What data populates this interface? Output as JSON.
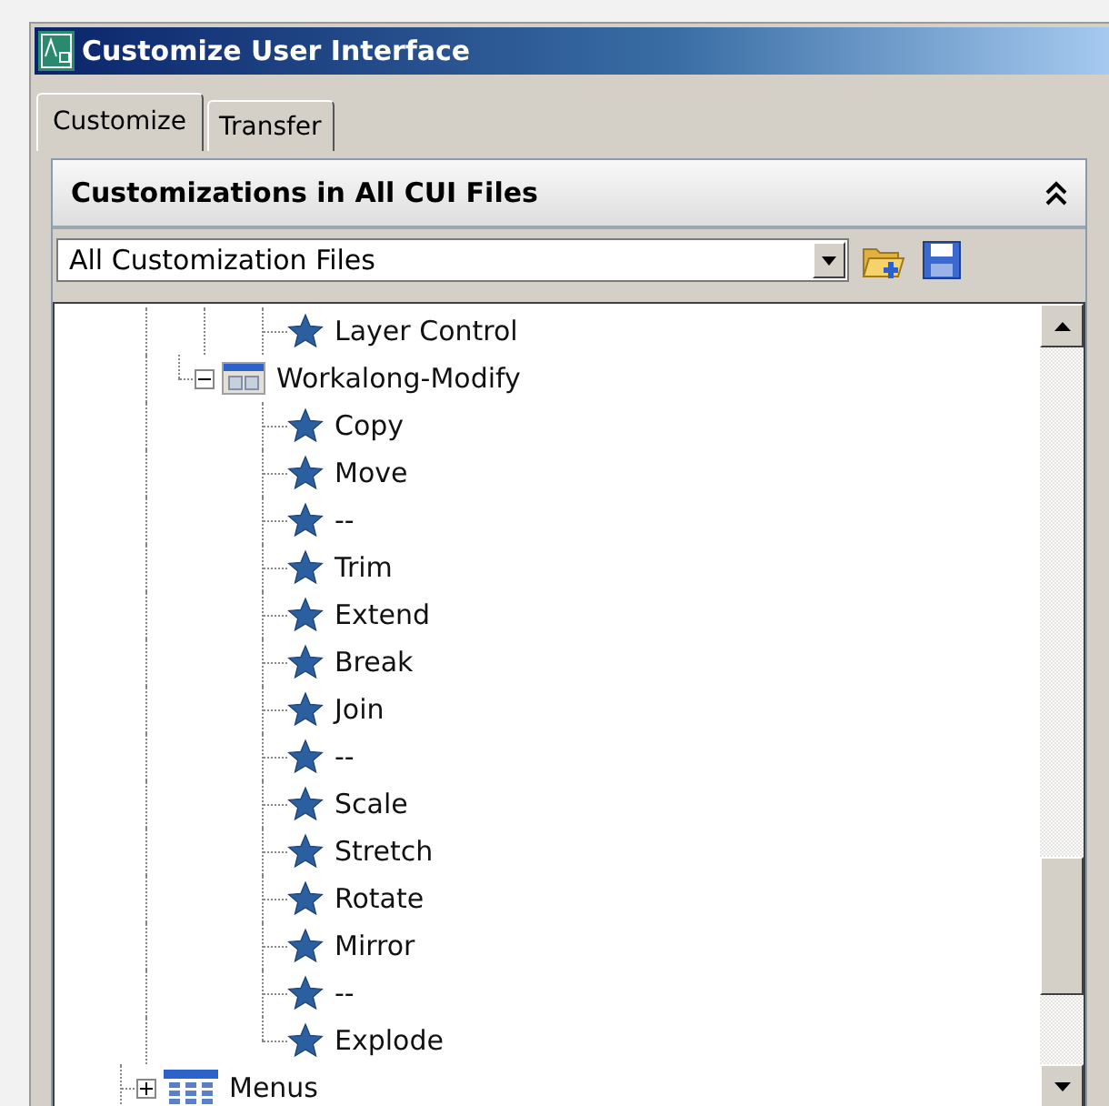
{
  "window": {
    "title": "Customize User Interface"
  },
  "tabs": [
    {
      "label": "Customize",
      "selected": true
    },
    {
      "label": "Transfer",
      "selected": false
    }
  ],
  "panel": {
    "title": "Customizations in All CUI Files",
    "expanded": true
  },
  "file_select": {
    "value": "All Customization Files"
  },
  "tree": {
    "items": [
      {
        "kind": "command",
        "label": "Layer Control"
      },
      {
        "kind": "toolbar",
        "label": "Workalong-Modify",
        "expanded": true,
        "children": [
          {
            "kind": "command",
            "label": "Copy"
          },
          {
            "kind": "command",
            "label": "Move"
          },
          {
            "kind": "command",
            "label": "--"
          },
          {
            "kind": "command",
            "label": "Trim"
          },
          {
            "kind": "command",
            "label": "Extend"
          },
          {
            "kind": "command",
            "label": "Break"
          },
          {
            "kind": "command",
            "label": "Join"
          },
          {
            "kind": "command",
            "label": "--"
          },
          {
            "kind": "command",
            "label": "Scale"
          },
          {
            "kind": "command",
            "label": "Stretch"
          },
          {
            "kind": "command",
            "label": "Rotate"
          },
          {
            "kind": "command",
            "label": "Mirror"
          },
          {
            "kind": "command",
            "label": "--"
          },
          {
            "kind": "command",
            "label": "Explode"
          }
        ]
      }
    ],
    "root_items": [
      {
        "kind": "menu",
        "label": "Menus",
        "expanded": false
      }
    ]
  }
}
